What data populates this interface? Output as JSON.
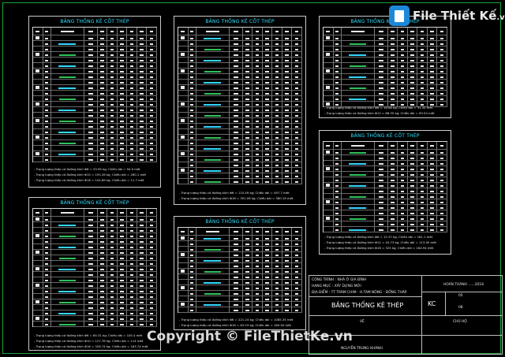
{
  "logo": {
    "brand": "File Thiết Kế",
    "suffix": ".vn"
  },
  "watermark": "Copyright © FileThietKe.vn",
  "sheets": [
    {
      "title": "BẢNG THỐNG KÊ CỐT THÉP",
      "notes": [
        "- Trọng lượng thép có đường kính Φ6 = 33.95 kg; Chiều dài = 94.9 mét",
        "- Trọng lượng thép có đường kính Φ10 = 193.26 kg; Chiều dài = 260.1 mét",
        "- Trọng lượng thép có đường kính Φ16 = 104.89 kg; Chiều dài = 11.7 mét"
      ]
    },
    {
      "title": "BẢNG THỐNG KÊ CỐT THÉP",
      "notes": [
        "- Trọng lượng thép có đường kính Φ6 = 110.49 kg; Chiều dài = 497.7 mét",
        "- Trọng lượng thép có đường kính Φ16 = 301.06 kg; Chiều dài = 380.19 mét"
      ]
    },
    {
      "title": "BẢNG THỐNG KÊ CỐT THÉP",
      "notes": [
        "- Trọng lượng thép có đường kính Φ6 = 16.08 kg; Chiều dài = 31.35 mét",
        "- Trọng lượng thép có đường kính Φ12 = 86.35 kg; Chiều dài = 93.54 mét"
      ]
    },
    {
      "title": "BẢNG THỐNG KÊ CỐT THÉP",
      "notes": [
        "- Trọng lượng thép có đường kính Φ6 = 12.37 kg; Chiều dài = 181.1 mét",
        "- Trọng lượng thép có đường kính Φ12 = 44.73 kg; Chiều dài = 113.40 mét",
        "- Trọng lượng thép có đường kính Φ16 = 325 kg; Chiều dài = 164.94 mét"
      ]
    },
    {
      "title": "BẢNG THỐNG KÊ CỐT THÉP",
      "notes": [
        "- Trọng lượng thép có đường kính Φ6 = 65.31 kg; Chiều dài = 105.4 mét",
        "- Trọng lượng thép có đường kính Φ10 = 127.78 kg; Chiều dài = 114 mét",
        "- Trọng lượng thép có đường kính Φ16 = 326.74 kg; Chiều dài = 183.74 mét"
      ]
    },
    {
      "title": "BẢNG THỐNG KÊ CỐT THÉP",
      "notes": [
        "- Trọng lượng thép có đường kính Φ6 = 221.24 kg; Chiều dài = 1085.35 mét",
        "- Trọng lượng thép có đường kính Φ16 = 63.53 kg; Chiều dài = 180.00 mét"
      ]
    }
  ],
  "title_block": {
    "project": "CÔNG TRÌNH : NHÀ Ở GIA ĐÌNH",
    "category": "HẠNG MỤC : XÂY DỰNG MỚI",
    "location": "ĐỊA ĐIỂM : TT TRÀM CHIM - H.TAM NÔNG - ĐỒNG THÁP",
    "completed": "HOÀN THÀNH ......2018",
    "drawing_title": "BẢNG THỐNG KÊ THÉP",
    "code": "KC",
    "sheet_no": "05",
    "sheet_total": "08",
    "drawn_label": "VẼ",
    "chief_label": "CHỦ HỘ",
    "drawn_by": "NGUYỄN TRUNG KHÁNH"
  }
}
